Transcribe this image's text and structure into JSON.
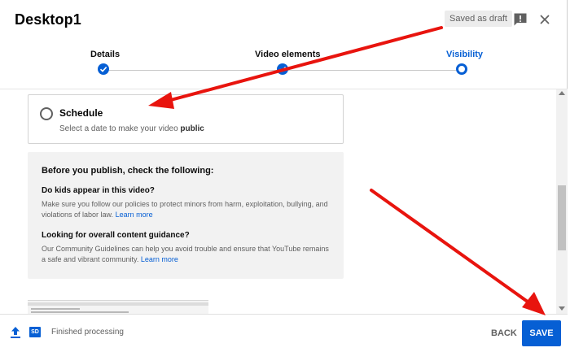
{
  "header": {
    "title": "Desktop1",
    "draft_badge": "Saved as draft",
    "feedback_icon": "feedback-icon",
    "close_icon": "close-icon"
  },
  "stepper": {
    "steps": [
      {
        "label": "Details",
        "state": "done"
      },
      {
        "label": "Video elements",
        "state": "done"
      },
      {
        "label": "Visibility",
        "state": "current"
      }
    ]
  },
  "schedule": {
    "title": "Schedule",
    "desc_prefix": "Select a date to make your video ",
    "desc_bold": "public"
  },
  "checklist": {
    "heading": "Before you publish, check the following:",
    "q1_title": "Do kids appear in this video?",
    "q1_body": "Make sure you follow our policies to protect minors from harm, exploitation, bullying, and violations of labor law.",
    "q1_link": "Learn more",
    "q2_title": "Looking for overall content guidance?",
    "q2_body": "Our Community Guidelines can help you avoid trouble and ensure that YouTube remains a safe and vibrant community.",
    "q2_link": "Learn more"
  },
  "footer": {
    "upload_icon": "upload-icon",
    "quality_badge": "SD",
    "status": "Finished processing",
    "back_label": "BACK",
    "save_label": "SAVE"
  },
  "colors": {
    "accent": "#065fd4",
    "annotation_arrow": "#e8140e"
  }
}
